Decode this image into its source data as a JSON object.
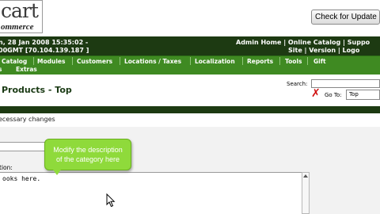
{
  "header": {
    "logo_main": "cart",
    "logo_sub": "ommerce",
    "update_button": "Check for Update"
  },
  "info_bar": {
    "line1": "n, 28 Jan 2008 15:35:02 -",
    "line2": "00GMT [70.104.139.187 ]",
    "right1": "Admin Home | Online Catalog | Suppo",
    "right2": "Site | Version | Logo"
  },
  "menu": {
    "items": [
      "Catalog",
      "Modules",
      "Customers",
      "Locations / Taxes",
      "Localization",
      "Reports",
      "Tools",
      "Gift"
    ],
    "extras": "Extras"
  },
  "title_bar": {
    "title": "Products - Top",
    "search_label": "Search:",
    "goto_label": "Go To:",
    "goto_value": "Top"
  },
  "content": {
    "note": "ecessary changes",
    "desc_label": "tion:",
    "desc_text": "ooks here."
  },
  "callout": {
    "line1": "Modify the description",
    "line2": "of the category here"
  },
  "colors": {
    "info_bar_bg": "#1d3a12",
    "menu_bg": "#3f8a22",
    "callout_bg": "#8fda3b",
    "x_icon": "#d01010"
  }
}
